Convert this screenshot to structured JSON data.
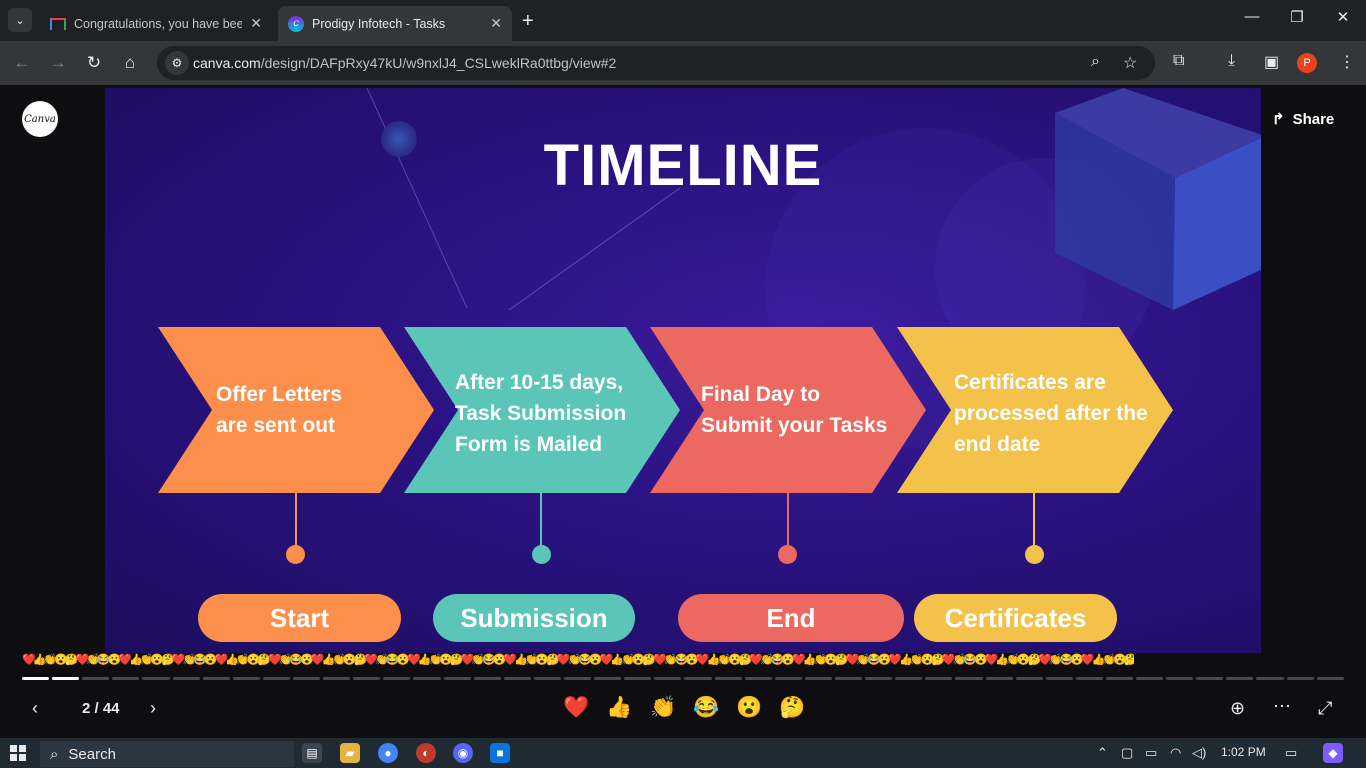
{
  "browser": {
    "tabs": [
      {
        "title": "Congratulations, you have been",
        "icon": "gmail-icon",
        "active": false
      },
      {
        "title": "Prodigy Infotech - Tasks",
        "icon": "canva-icon",
        "active": true
      }
    ],
    "url_host": "canva.com",
    "url_path": "/design/DAFpRxy47kU/w9nxlJ4_CSLweklRa0ttbg/view#2",
    "profile_initial": "P"
  },
  "canva": {
    "logo_text": "Canva",
    "share_label": "Share",
    "page_indicator": "2 / 44",
    "current_page": 2,
    "total_pages": 44
  },
  "slide": {
    "title": "TIMELINE",
    "steps": [
      {
        "label_lines": [
          "Offer Letters",
          "are sent out"
        ],
        "pill": "Start",
        "color": "#fd8f4d"
      },
      {
        "label_lines": [
          "After 10-15 days,",
          "Task Submission",
          "Form is Mailed"
        ],
        "pill": "Submission",
        "color": "#5bc6b7"
      },
      {
        "label_lines": [
          "Final Day to",
          "Submit your Tasks"
        ],
        "pill": "End",
        "color": "#eb6961"
      },
      {
        "label_lines": [
          "Certificates are",
          "processed after the",
          "end date"
        ],
        "pill": "Certificates",
        "color": "#f4c24a"
      }
    ],
    "background": "#2a1280"
  },
  "reactions": [
    {
      "name": "heart",
      "glyph": "❤️"
    },
    {
      "name": "thumbs-up",
      "glyph": "👍"
    },
    {
      "name": "clap",
      "glyph": "👏"
    },
    {
      "name": "laugh",
      "glyph": "😂"
    },
    {
      "name": "surprised",
      "glyph": "😮"
    },
    {
      "name": "thinking",
      "glyph": "🤔"
    }
  ],
  "taskbar": {
    "search_label": "Search",
    "time": "1:02 PM"
  },
  "colors": {
    "chrome_dark": "#202124",
    "chrome_toolbar": "#35363a",
    "viewer_bg": "#0e0e10"
  }
}
